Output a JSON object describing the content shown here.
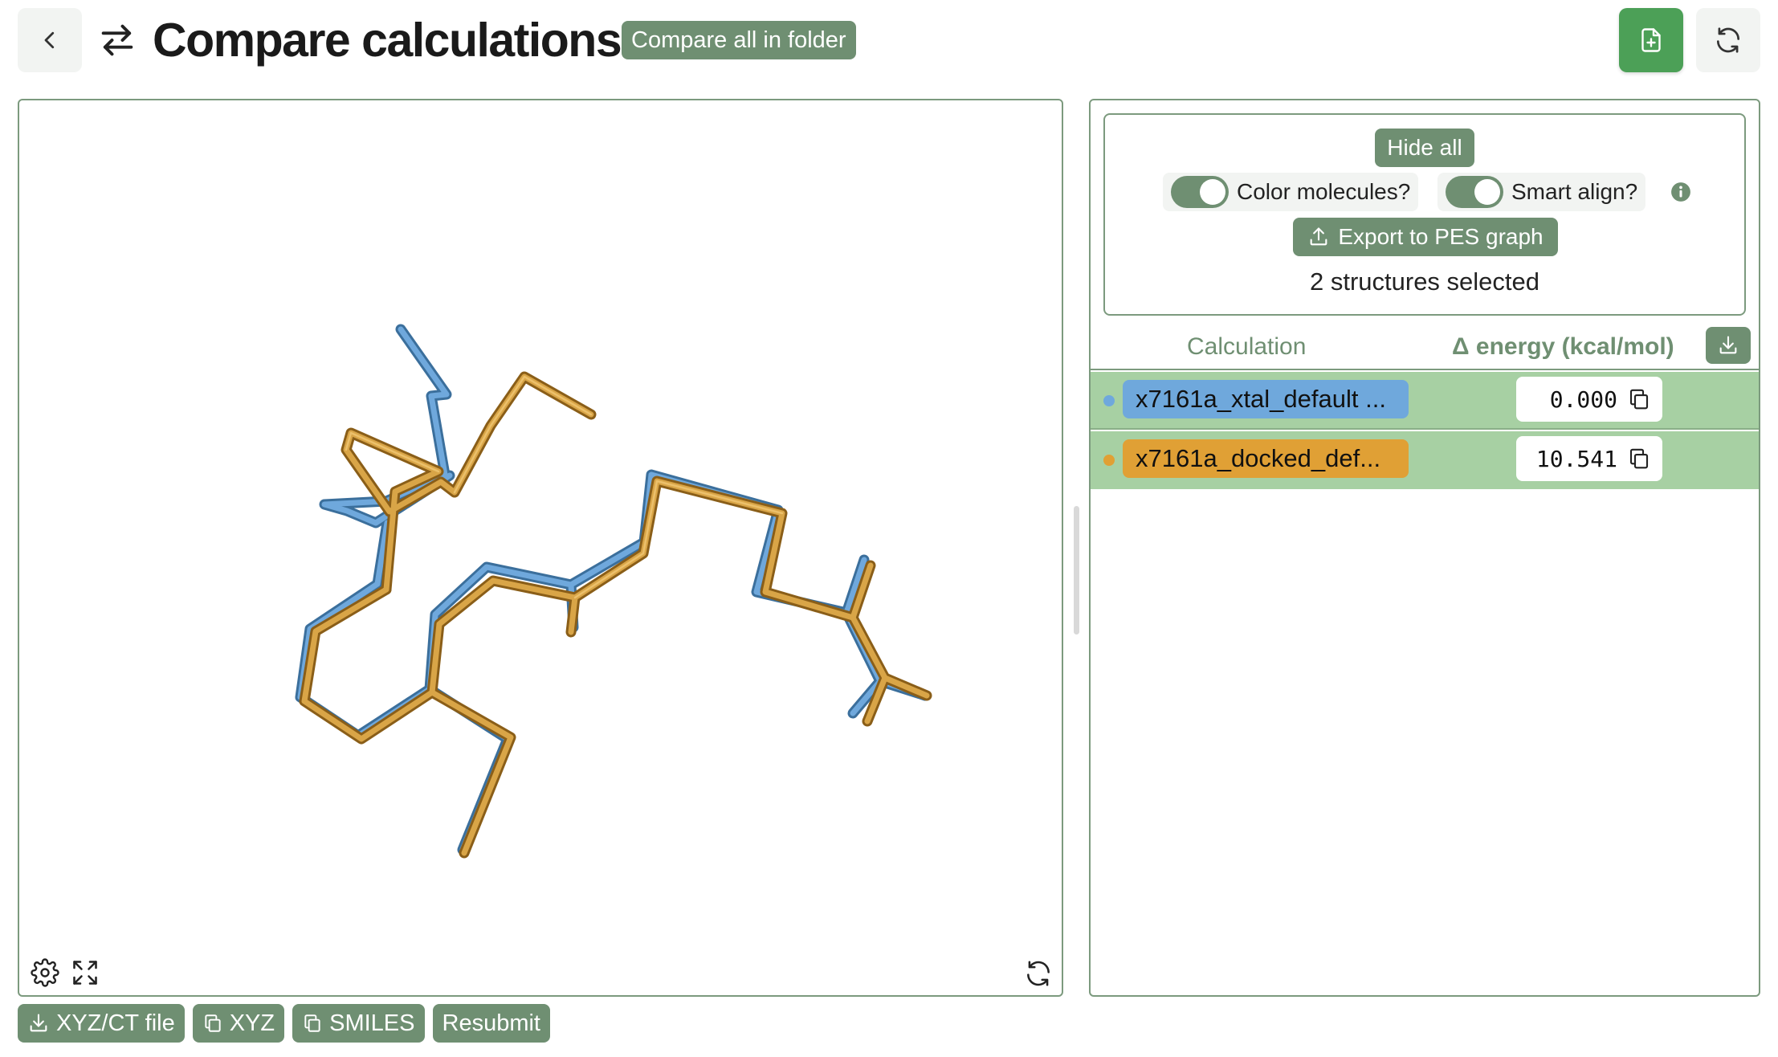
{
  "header": {
    "title": "Compare calculations",
    "compare_folder_label": "Compare all in folder"
  },
  "icons": {
    "back": "chevron-left-icon",
    "swap": "swap-arrows-icon",
    "new_file": "file-plus-icon",
    "refresh": "refresh-icon",
    "viewer_settings": "gear-icon",
    "viewer_fullscreen": "expand-icon",
    "viewer_reset": "rotate-icon",
    "info": "info-icon",
    "upload": "upload-icon",
    "download": "download-icon",
    "copy": "copy-icon"
  },
  "colors": {
    "accent_green": "#6f8f72",
    "new_file_green": "#4ca057",
    "row_selected": "#a7d0a3",
    "structure_1": "#6fa8dc",
    "structure_2": "#e0a035"
  },
  "bottom_actions": [
    {
      "label": "XYZ/CT file",
      "icon": "download-icon"
    },
    {
      "label": "XYZ",
      "icon": "copy-icon"
    },
    {
      "label": "SMILES",
      "icon": "copy-icon"
    },
    {
      "label": "Resubmit",
      "icon": ""
    }
  ],
  "controls": {
    "hide_all_label": "Hide all",
    "color_molecules_label": "Color molecules?",
    "color_molecules_on": true,
    "smart_align_label": "Smart align?",
    "smart_align_on": true,
    "export_label": "Export to PES graph",
    "selected_text": "2 structures selected"
  },
  "table": {
    "col_calculation": "Calculation",
    "col_energy": "Δ energy (kcal/mol)",
    "rows": [
      {
        "name": "x7161a_xtal_default ...",
        "energy": "0.000",
        "color": "#6fa8dc"
      },
      {
        "name": "x7161a_docked_def...",
        "energy": "10.541",
        "color": "#e0a035"
      }
    ]
  }
}
